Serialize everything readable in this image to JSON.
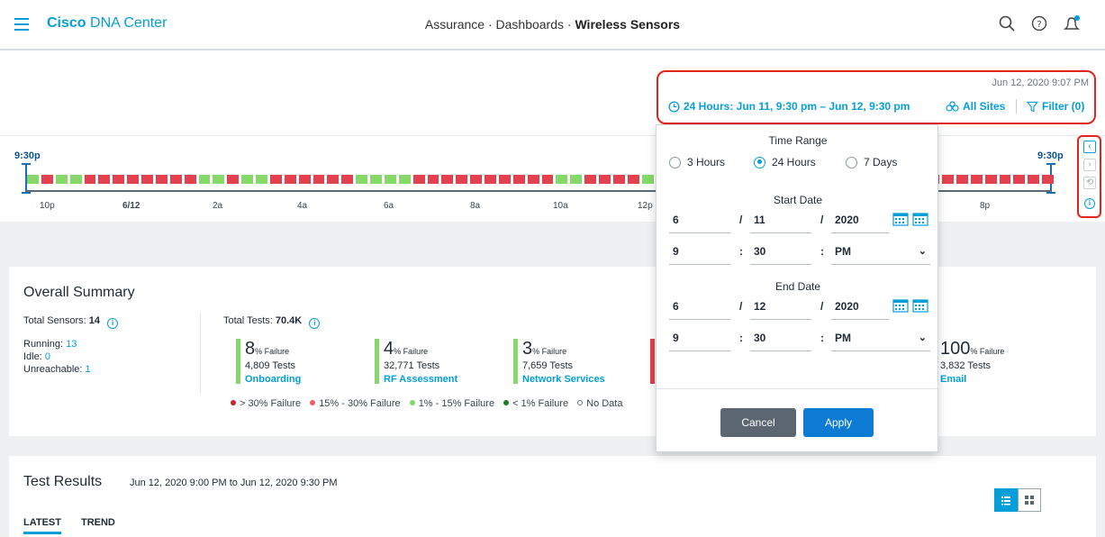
{
  "header": {
    "brand_bold": "Cisco",
    "brand_rest": "DNA Center",
    "breadcrumb_1": "Assurance",
    "breadcrumb_sep": "·",
    "breadcrumb_2": "Dashboards",
    "breadcrumb_3": "Wireless Sensors",
    "icons": [
      "menu-icon",
      "search-icon",
      "help-icon",
      "notification-icon"
    ]
  },
  "toolbar": {
    "timestamp": "Jun 12, 2020 9:07 PM",
    "time_range": "24 Hours: Jun 11, 9:30 pm – Jun 12, 9:30 pm",
    "sites": "All Sites",
    "filter": "Filter (0)"
  },
  "timeline": {
    "start_label": "9:30p",
    "end_label": "9:30p",
    "segments": [
      "g",
      "r",
      "g",
      "g",
      "r",
      "r",
      "r",
      "r",
      "r",
      "r",
      "r",
      "r",
      "g",
      "g",
      "r",
      "g",
      "g",
      "r",
      "r",
      "r",
      "r",
      "r",
      "r",
      "g",
      "g",
      "g",
      "g",
      "r",
      "r",
      "r",
      "r",
      "r",
      "r",
      "r",
      "r",
      "r",
      "r",
      "g",
      "g",
      "r",
      "r",
      "r",
      "r",
      "g",
      "g",
      "g",
      "g",
      "g",
      "g",
      "g",
      "r",
      "r",
      "g",
      "r",
      "r",
      "r",
      "r",
      "r",
      "r",
      "r",
      "g",
      "r",
      "r",
      "r",
      "r",
      "r",
      "r",
      "r",
      "r",
      "r",
      "r",
      "r"
    ],
    "ticks": [
      "10p",
      "6/12",
      "2a",
      "4a",
      "6a",
      "8a",
      "10a",
      "12p",
      "8p"
    ]
  },
  "summary": {
    "title": "Overall Summary",
    "total_sensors_label": "Total Sensors:",
    "total_sensors": "14",
    "running_label": "Running:",
    "running": "13",
    "idle_label": "Idle:",
    "idle": "0",
    "unreachable_label": "Unreachable:",
    "unreachable": "1",
    "total_tests_label": "Total Tests:",
    "total_tests": "70.4K",
    "failure_word": "% Failure",
    "cards": [
      {
        "pct": "8",
        "tests": "4,809 Tests",
        "name": "Onboarding",
        "color": "#86d86a"
      },
      {
        "pct": "4",
        "tests": "32,771 Tests",
        "name": "RF Assessment",
        "color": "#86d86a"
      },
      {
        "pct": "3",
        "tests": "7,659 Tests",
        "name": "Network Services",
        "color": "#86d86a"
      },
      {
        "pct": "100",
        "tests": "3,832 Tests",
        "name": "Email",
        "color": "#e2424f"
      }
    ],
    "legend": [
      "> 30% Failure",
      "15% - 30% Failure",
      "1% - 15% Failure",
      "< 1% Failure",
      "No Data"
    ]
  },
  "results": {
    "title": "Test Results",
    "range": "Jun 12, 2020 9:00 PM to Jun 12, 2020 9:30 PM",
    "tab_latest": "LATEST",
    "tab_trend": "TREND"
  },
  "popover": {
    "time_range_title": "Time Range",
    "options": [
      "3 Hours",
      "24 Hours",
      "7 Days"
    ],
    "selected": "24 Hours",
    "start_title": "Start Date",
    "start": {
      "month": "6",
      "day": "11",
      "year": "2020",
      "hour": "9",
      "minute": "30",
      "ampm": "PM"
    },
    "end_title": "End Date",
    "end": {
      "month": "6",
      "day": "12",
      "year": "2020",
      "hour": "9",
      "minute": "30",
      "ampm": "PM"
    },
    "date_sep": "/",
    "time_sep": ":",
    "cancel": "Cancel",
    "apply": "Apply"
  },
  "colors": {
    "accent": "#049fd9",
    "fail_high": "#e2424f",
    "fail_low": "#86d86a",
    "highlight": "#e3241b"
  }
}
